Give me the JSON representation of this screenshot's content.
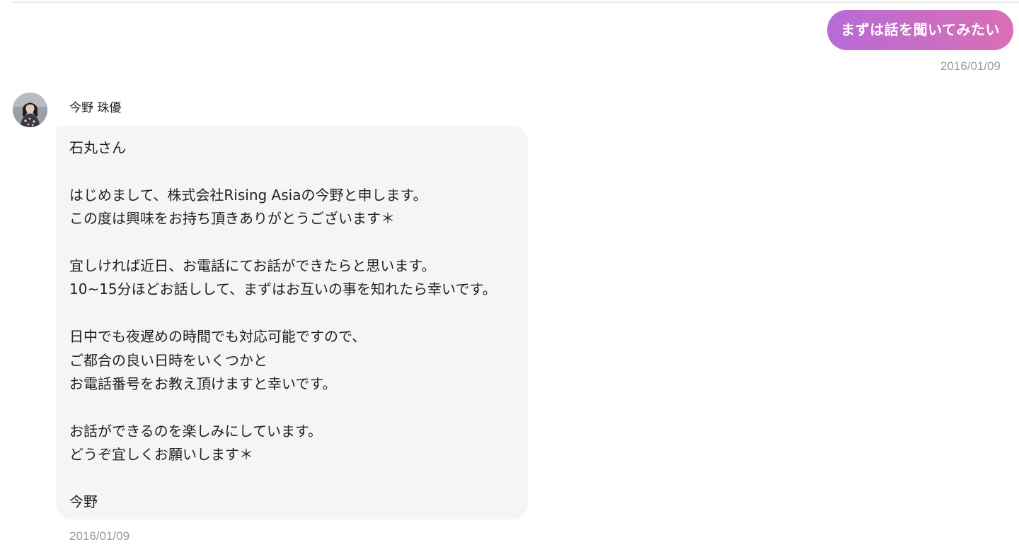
{
  "sent_message": {
    "text": "まずは話を聞いてみたい",
    "date": "2016/01/09",
    "gradient": [
      "#b66bd6",
      "#d96fb4"
    ]
  },
  "received_message": {
    "sender_name": "今野 珠優",
    "avatar": "user-avatar-photo",
    "lines": [
      "石丸さん",
      "",
      "はじめまして、株式会社Rising Asiaの今野と申します。",
      "この度は興味をお持ち頂きありがとうございます＊",
      "",
      "宜しければ近日、お電話にてお話ができたらと思います。",
      "10~15分ほどお話しして、まずはお互いの事を知れたら幸いです。",
      "",
      "日中でも夜遅めの時間でも対応可能ですので、",
      "ご都合の良い日時をいくつかと",
      "お電話番号をお教え頂けますと幸いです。",
      "",
      "お話ができるのを楽しみにしています。",
      "どうぞ宜しくお願いします＊",
      "",
      "今野"
    ],
    "date": "2016/01/09",
    "bubble_color": "#f5f5f5"
  }
}
